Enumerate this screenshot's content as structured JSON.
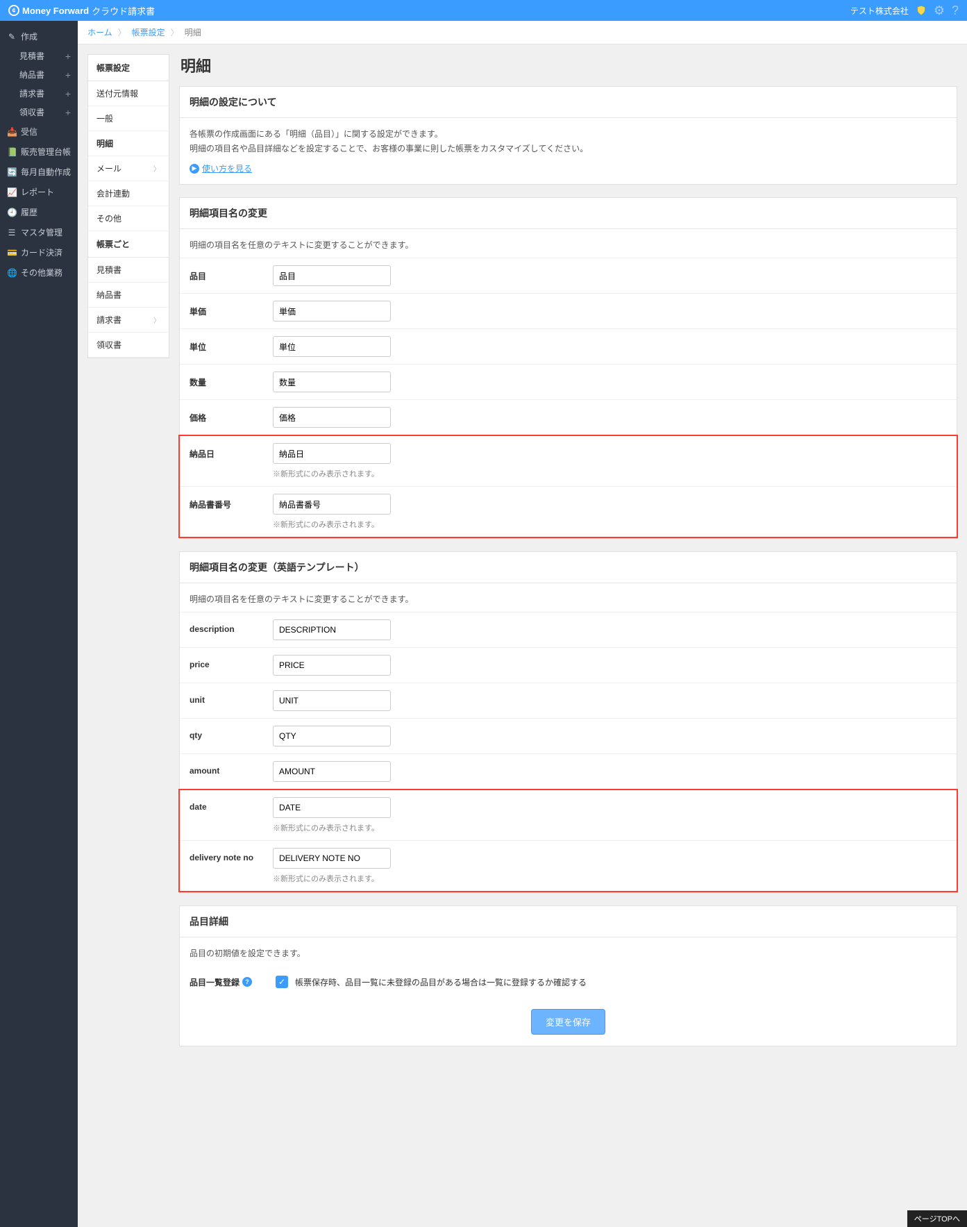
{
  "header": {
    "logo_brand": "Money Forward",
    "logo_product": "クラウド請求書",
    "company": "テスト株式会社"
  },
  "sidebar_dark": {
    "create": "作成",
    "create_subs": [
      "見積書",
      "納品書",
      "請求書",
      "領収書"
    ],
    "items": [
      {
        "icon": "📥",
        "label": "受信"
      },
      {
        "icon": "📗",
        "label": "販売管理台帳"
      },
      {
        "icon": "🔄",
        "label": "毎月自動作成"
      },
      {
        "icon": "📈",
        "label": "レポート"
      },
      {
        "icon": "🕘",
        "label": "履歴"
      },
      {
        "icon": "☰",
        "label": "マスタ管理"
      },
      {
        "icon": "💳",
        "label": "カード決済"
      },
      {
        "icon": "🌐",
        "label": "その他業務"
      }
    ]
  },
  "breadcrumb": {
    "home": "ホーム",
    "settings": "帳票設定",
    "current": "明細"
  },
  "settings_nav": {
    "header1": "帳票設定",
    "items1": [
      "送付元情報",
      "一般",
      "明細",
      "メール",
      "会計連動",
      "その他"
    ],
    "header2": "帳票ごと",
    "items2": [
      "見積書",
      "納品書",
      "請求書",
      "領収書"
    ]
  },
  "page_title": "明細",
  "section_about": {
    "title": "明細の設定について",
    "p1": "各帳票の作成画面にある「明細（品目）」に関する設定ができます。",
    "p2": "明細の項目名や品目詳細などを設定することで、お客様の事業に則した帳票をカスタマイズしてください。",
    "howto": "使い方を見る"
  },
  "section_names": {
    "title": "明細項目名の変更",
    "desc": "明細の項目名を任意のテキストに変更することができます。",
    "rows": [
      {
        "label": "品目",
        "value": "品目"
      },
      {
        "label": "単価",
        "value": "単価"
      },
      {
        "label": "単位",
        "value": "単位"
      },
      {
        "label": "数量",
        "value": "数量"
      },
      {
        "label": "価格",
        "value": "価格"
      }
    ],
    "highlight_rows": [
      {
        "label": "納品日",
        "value": "納品日",
        "note": "※新形式にのみ表示されます。"
      },
      {
        "label": "納品書番号",
        "value": "納品書番号",
        "note": "※新形式にのみ表示されます。"
      }
    ]
  },
  "section_names_en": {
    "title": "明細項目名の変更（英語テンプレート）",
    "desc": "明細の項目名を任意のテキストに変更することができます。",
    "rows": [
      {
        "label": "description",
        "value": "DESCRIPTION"
      },
      {
        "label": "price",
        "value": "PRICE"
      },
      {
        "label": "unit",
        "value": "UNIT"
      },
      {
        "label": "qty",
        "value": "QTY"
      },
      {
        "label": "amount",
        "value": "AMOUNT"
      }
    ],
    "highlight_rows": [
      {
        "label": "date",
        "value": "DATE",
        "note": "※新形式にのみ表示されます。"
      },
      {
        "label": "delivery note no",
        "value": "DELIVERY NOTE NO",
        "note": "※新形式にのみ表示されます。"
      }
    ]
  },
  "section_detail": {
    "title": "品目詳細",
    "desc": "品目の初期値を設定できます。",
    "row_label": "品目一覧登録",
    "row_text": "帳票保存時、品目一覧に未登録の品目がある場合は一覧に登録するか確認する"
  },
  "save_label": "変更を保存",
  "pagetop": "ページTOPへ"
}
